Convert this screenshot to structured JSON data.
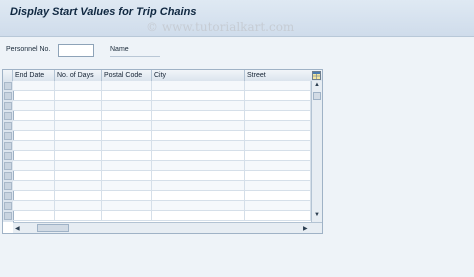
{
  "window": {
    "title": "Display Start Values for Trip Chains",
    "watermark": "© www.tutorialkart.com"
  },
  "fields": {
    "personnel_label": "Personnel No.",
    "personnel_value": "",
    "name_label": "Name"
  },
  "table": {
    "columns": [
      "End Date",
      "No. of Days",
      "Postal Code",
      "City",
      "Street"
    ],
    "rows": [
      [
        "",
        "",
        "",
        "",
        ""
      ],
      [
        "",
        "",
        "",
        "",
        ""
      ],
      [
        "",
        "",
        "",
        "",
        ""
      ],
      [
        "",
        "",
        "",
        "",
        ""
      ],
      [
        "",
        "",
        "",
        "",
        ""
      ],
      [
        "",
        "",
        "",
        "",
        ""
      ],
      [
        "",
        "",
        "",
        "",
        ""
      ],
      [
        "",
        "",
        "",
        "",
        ""
      ],
      [
        "",
        "",
        "",
        "",
        ""
      ],
      [
        "",
        "",
        "",
        "",
        ""
      ],
      [
        "",
        "",
        "",
        "",
        ""
      ],
      [
        "",
        "",
        "",
        "",
        ""
      ],
      [
        "",
        "",
        "",
        "",
        ""
      ],
      [
        "",
        "",
        "",
        "",
        ""
      ]
    ]
  },
  "icons": {
    "layout": "table-layout-icon",
    "scroll_up": "▲",
    "scroll_down": "▼",
    "scroll_left": "◀",
    "scroll_right": "▶"
  }
}
